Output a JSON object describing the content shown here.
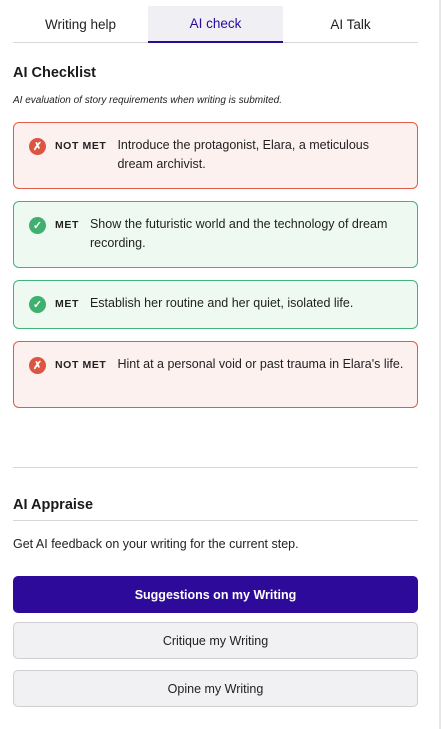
{
  "tabs": [
    {
      "label": "Writing help",
      "active": false
    },
    {
      "label": "AI check",
      "active": true
    },
    {
      "label": "AI Talk",
      "active": false
    }
  ],
  "checklist": {
    "title": "AI Checklist",
    "subtitle": "AI evaluation of story requirements when writing is submited.",
    "items": [
      {
        "status": "not-met",
        "status_label": "NOT MET",
        "icon": "x-icon",
        "text": "Introduce the protagonist, Elara, a meticulous dream archivist."
      },
      {
        "status": "met",
        "status_label": "MET",
        "icon": "check-icon",
        "text": "Show the futuristic world and the technology of dream recording."
      },
      {
        "status": "met",
        "status_label": "MET",
        "icon": "check-icon",
        "text": "Establish her routine and her quiet, isolated life."
      },
      {
        "status": "not-met",
        "status_label": "NOT MET",
        "icon": "x-icon",
        "text": "Hint at a personal void or past trauma in Elara's life."
      }
    ]
  },
  "appraise": {
    "title": "AI Appraise",
    "description": "Get AI feedback on your writing for the current step.",
    "buttons": {
      "suggestions": "Suggestions on my Writing",
      "critique": "Critique my Writing",
      "opine": "Opine my Writing"
    }
  },
  "colors": {
    "accent": "#2e0a9a",
    "met": "#3fb06f",
    "not_met": "#dc5442"
  }
}
